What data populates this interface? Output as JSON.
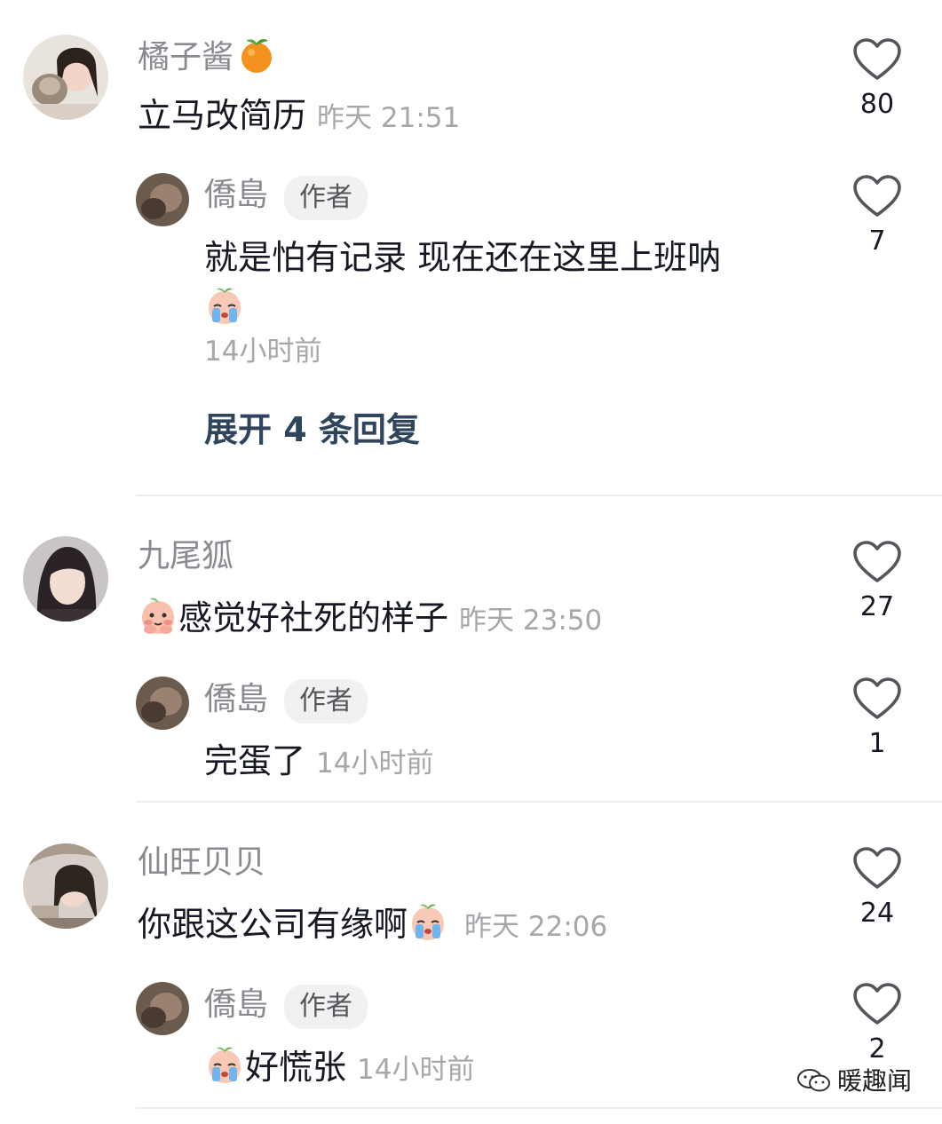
{
  "comments": [
    {
      "name": "橘子酱",
      "text": "立马改简历",
      "time": "昨天 21:51",
      "likes": "80",
      "reply": {
        "name": "僑島",
        "badge": "作者",
        "text": "就是怕有记录 现在还在这里上班呐",
        "time": "14小时前",
        "likes": "7"
      },
      "expand_label": "展开 4 条回复"
    },
    {
      "name": "九尾狐",
      "text": "感觉好社死的样子",
      "time": "昨天 23:50",
      "likes": "27",
      "reply": {
        "name": "僑島",
        "badge": "作者",
        "text": "完蛋了",
        "time": "14小时前",
        "likes": "1"
      }
    },
    {
      "name": "仙旺贝贝",
      "text": "你跟这公司有缘啊",
      "time": "昨天 22:06",
      "likes": "24",
      "reply": {
        "name": "僑島",
        "badge": "作者",
        "text": "好慌张",
        "time": "14小时前",
        "likes": "2"
      }
    }
  ],
  "icons": {
    "like": "heart-outline-icon",
    "orange": "tangerine-emoji-icon",
    "cry": "crying-peach-emoji-icon",
    "shy": "shy-peach-emoji-icon",
    "wechat": "wechat-icon"
  },
  "watermark": "暖趣闻",
  "colors": {
    "name": "#8a8b91",
    "text": "#161823",
    "time": "#a6a7ab",
    "expand": "#30455c",
    "badge_bg": "#f1f1f2"
  }
}
